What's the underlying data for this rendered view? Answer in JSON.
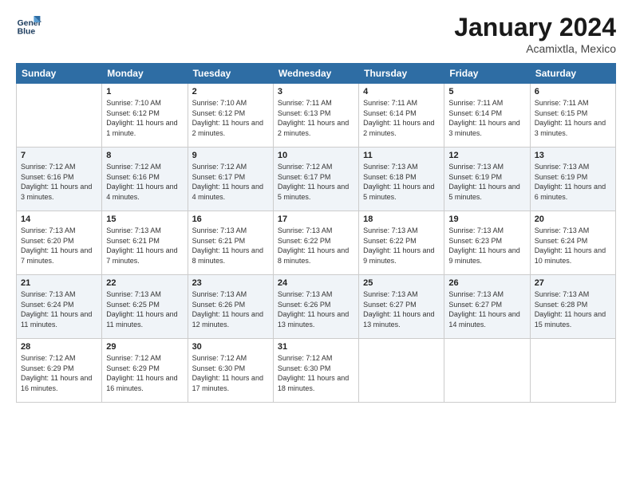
{
  "header": {
    "logo_line1": "General",
    "logo_line2": "Blue",
    "month_title": "January 2024",
    "subtitle": "Acamixtla, Mexico"
  },
  "days_of_week": [
    "Sunday",
    "Monday",
    "Tuesday",
    "Wednesday",
    "Thursday",
    "Friday",
    "Saturday"
  ],
  "weeks": [
    [
      {
        "day": "",
        "sunrise": "",
        "sunset": "",
        "daylight": ""
      },
      {
        "day": "1",
        "sunrise": "Sunrise: 7:10 AM",
        "sunset": "Sunset: 6:12 PM",
        "daylight": "Daylight: 11 hours and 1 minute."
      },
      {
        "day": "2",
        "sunrise": "Sunrise: 7:10 AM",
        "sunset": "Sunset: 6:12 PM",
        "daylight": "Daylight: 11 hours and 2 minutes."
      },
      {
        "day": "3",
        "sunrise": "Sunrise: 7:11 AM",
        "sunset": "Sunset: 6:13 PM",
        "daylight": "Daylight: 11 hours and 2 minutes."
      },
      {
        "day": "4",
        "sunrise": "Sunrise: 7:11 AM",
        "sunset": "Sunset: 6:14 PM",
        "daylight": "Daylight: 11 hours and 2 minutes."
      },
      {
        "day": "5",
        "sunrise": "Sunrise: 7:11 AM",
        "sunset": "Sunset: 6:14 PM",
        "daylight": "Daylight: 11 hours and 3 minutes."
      },
      {
        "day": "6",
        "sunrise": "Sunrise: 7:11 AM",
        "sunset": "Sunset: 6:15 PM",
        "daylight": "Daylight: 11 hours and 3 minutes."
      }
    ],
    [
      {
        "day": "7",
        "sunrise": "Sunrise: 7:12 AM",
        "sunset": "Sunset: 6:16 PM",
        "daylight": "Daylight: 11 hours and 3 minutes."
      },
      {
        "day": "8",
        "sunrise": "Sunrise: 7:12 AM",
        "sunset": "Sunset: 6:16 PM",
        "daylight": "Daylight: 11 hours and 4 minutes."
      },
      {
        "day": "9",
        "sunrise": "Sunrise: 7:12 AM",
        "sunset": "Sunset: 6:17 PM",
        "daylight": "Daylight: 11 hours and 4 minutes."
      },
      {
        "day": "10",
        "sunrise": "Sunrise: 7:12 AM",
        "sunset": "Sunset: 6:17 PM",
        "daylight": "Daylight: 11 hours and 5 minutes."
      },
      {
        "day": "11",
        "sunrise": "Sunrise: 7:13 AM",
        "sunset": "Sunset: 6:18 PM",
        "daylight": "Daylight: 11 hours and 5 minutes."
      },
      {
        "day": "12",
        "sunrise": "Sunrise: 7:13 AM",
        "sunset": "Sunset: 6:19 PM",
        "daylight": "Daylight: 11 hours and 5 minutes."
      },
      {
        "day": "13",
        "sunrise": "Sunrise: 7:13 AM",
        "sunset": "Sunset: 6:19 PM",
        "daylight": "Daylight: 11 hours and 6 minutes."
      }
    ],
    [
      {
        "day": "14",
        "sunrise": "Sunrise: 7:13 AM",
        "sunset": "Sunset: 6:20 PM",
        "daylight": "Daylight: 11 hours and 7 minutes."
      },
      {
        "day": "15",
        "sunrise": "Sunrise: 7:13 AM",
        "sunset": "Sunset: 6:21 PM",
        "daylight": "Daylight: 11 hours and 7 minutes."
      },
      {
        "day": "16",
        "sunrise": "Sunrise: 7:13 AM",
        "sunset": "Sunset: 6:21 PM",
        "daylight": "Daylight: 11 hours and 8 minutes."
      },
      {
        "day": "17",
        "sunrise": "Sunrise: 7:13 AM",
        "sunset": "Sunset: 6:22 PM",
        "daylight": "Daylight: 11 hours and 8 minutes."
      },
      {
        "day": "18",
        "sunrise": "Sunrise: 7:13 AM",
        "sunset": "Sunset: 6:22 PM",
        "daylight": "Daylight: 11 hours and 9 minutes."
      },
      {
        "day": "19",
        "sunrise": "Sunrise: 7:13 AM",
        "sunset": "Sunset: 6:23 PM",
        "daylight": "Daylight: 11 hours and 9 minutes."
      },
      {
        "day": "20",
        "sunrise": "Sunrise: 7:13 AM",
        "sunset": "Sunset: 6:24 PM",
        "daylight": "Daylight: 11 hours and 10 minutes."
      }
    ],
    [
      {
        "day": "21",
        "sunrise": "Sunrise: 7:13 AM",
        "sunset": "Sunset: 6:24 PM",
        "daylight": "Daylight: 11 hours and 11 minutes."
      },
      {
        "day": "22",
        "sunrise": "Sunrise: 7:13 AM",
        "sunset": "Sunset: 6:25 PM",
        "daylight": "Daylight: 11 hours and 11 minutes."
      },
      {
        "day": "23",
        "sunrise": "Sunrise: 7:13 AM",
        "sunset": "Sunset: 6:26 PM",
        "daylight": "Daylight: 11 hours and 12 minutes."
      },
      {
        "day": "24",
        "sunrise": "Sunrise: 7:13 AM",
        "sunset": "Sunset: 6:26 PM",
        "daylight": "Daylight: 11 hours and 13 minutes."
      },
      {
        "day": "25",
        "sunrise": "Sunrise: 7:13 AM",
        "sunset": "Sunset: 6:27 PM",
        "daylight": "Daylight: 11 hours and 13 minutes."
      },
      {
        "day": "26",
        "sunrise": "Sunrise: 7:13 AM",
        "sunset": "Sunset: 6:27 PM",
        "daylight": "Daylight: 11 hours and 14 minutes."
      },
      {
        "day": "27",
        "sunrise": "Sunrise: 7:13 AM",
        "sunset": "Sunset: 6:28 PM",
        "daylight": "Daylight: 11 hours and 15 minutes."
      }
    ],
    [
      {
        "day": "28",
        "sunrise": "Sunrise: 7:12 AM",
        "sunset": "Sunset: 6:29 PM",
        "daylight": "Daylight: 11 hours and 16 minutes."
      },
      {
        "day": "29",
        "sunrise": "Sunrise: 7:12 AM",
        "sunset": "Sunset: 6:29 PM",
        "daylight": "Daylight: 11 hours and 16 minutes."
      },
      {
        "day": "30",
        "sunrise": "Sunrise: 7:12 AM",
        "sunset": "Sunset: 6:30 PM",
        "daylight": "Daylight: 11 hours and 17 minutes."
      },
      {
        "day": "31",
        "sunrise": "Sunrise: 7:12 AM",
        "sunset": "Sunset: 6:30 PM",
        "daylight": "Daylight: 11 hours and 18 minutes."
      },
      {
        "day": "",
        "sunrise": "",
        "sunset": "",
        "daylight": ""
      },
      {
        "day": "",
        "sunrise": "",
        "sunset": "",
        "daylight": ""
      },
      {
        "day": "",
        "sunrise": "",
        "sunset": "",
        "daylight": ""
      }
    ]
  ]
}
